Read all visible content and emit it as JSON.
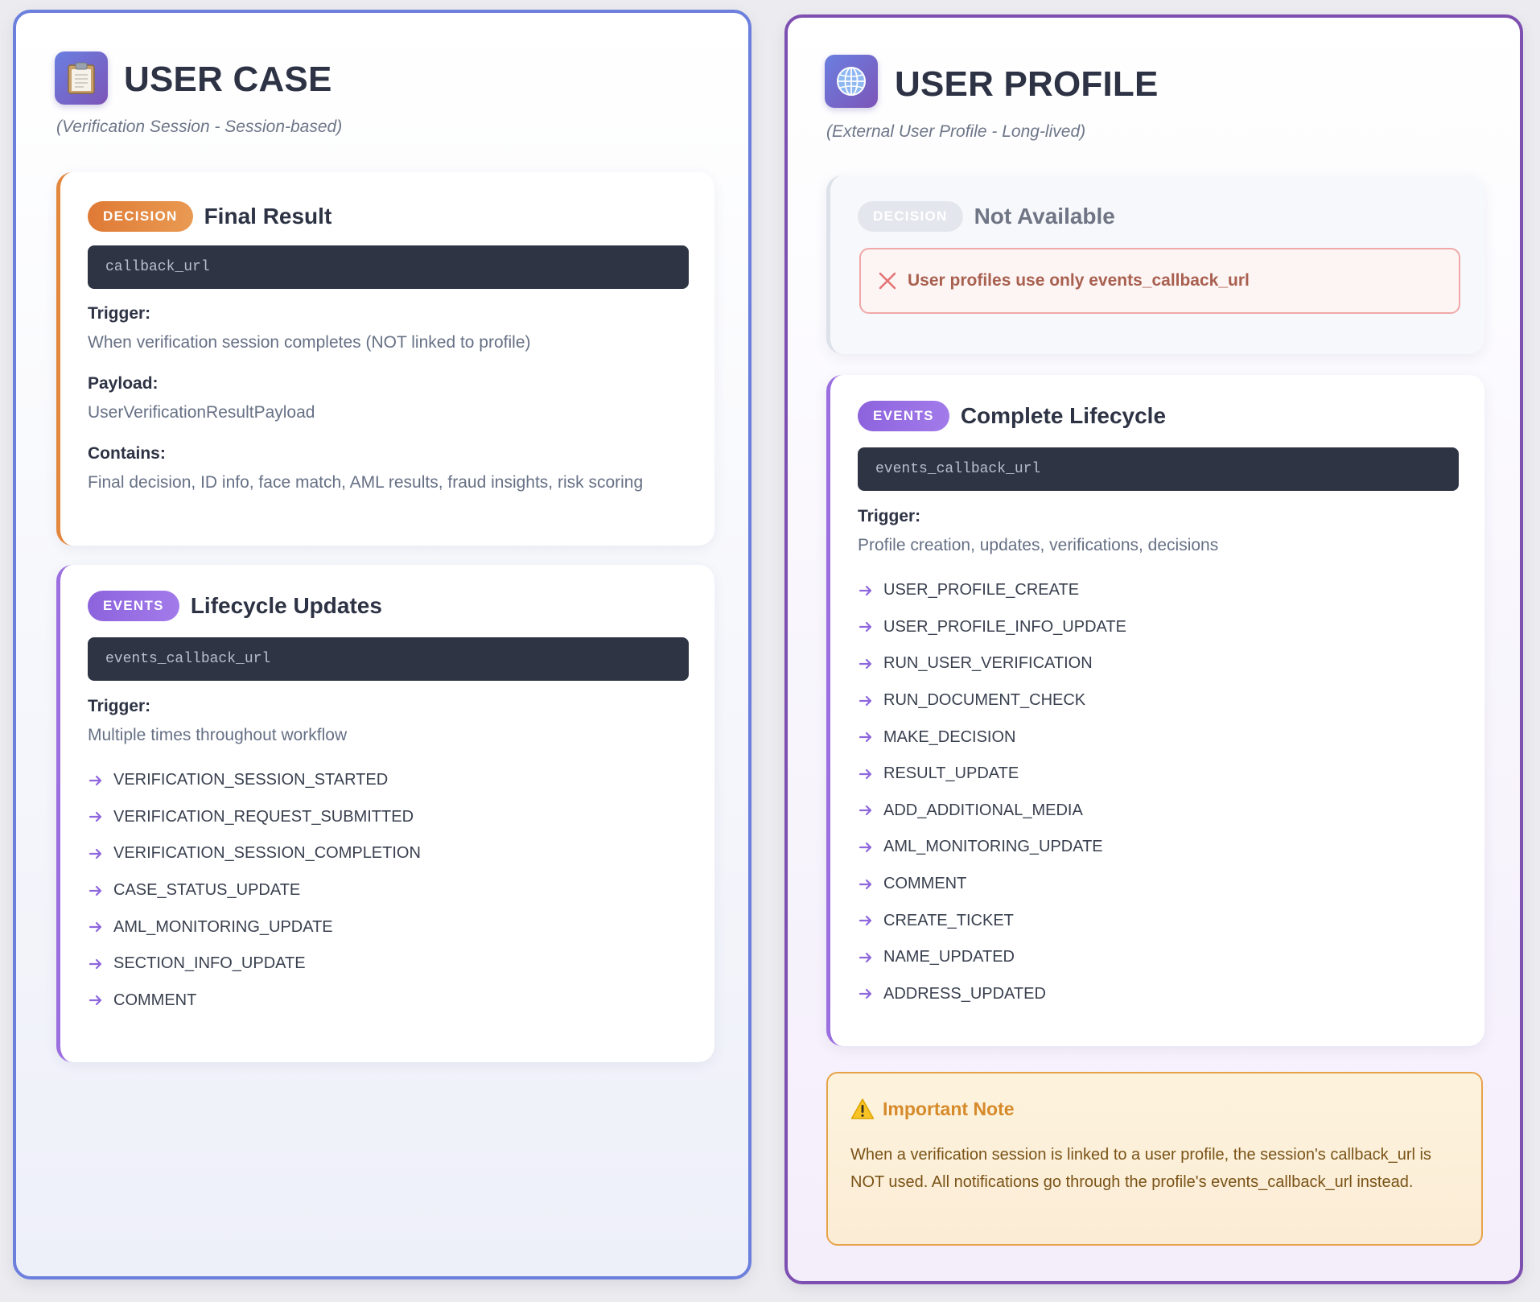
{
  "user_case": {
    "title": "USER CASE",
    "subtitle": "(Verification Session - Session-based)",
    "icon": "clipboard-icon",
    "decision_card": {
      "badge": "DECISION",
      "title": "Final Result",
      "code": "callback_url",
      "trigger_label": "Trigger:",
      "trigger_value": "When verification session completes (NOT linked to profile)",
      "payload_label": "Payload:",
      "payload_value": "UserVerificationResultPayload",
      "contains_label": "Contains:",
      "contains_value": "Final decision, ID info, face match, AML results, fraud insights, risk scoring"
    },
    "events_card": {
      "badge": "EVENTS",
      "title": "Lifecycle Updates",
      "code": "events_callback_url",
      "trigger_label": "Trigger:",
      "trigger_value": "Multiple times throughout workflow",
      "events": [
        "VERIFICATION_SESSION_STARTED",
        "VERIFICATION_REQUEST_SUBMITTED",
        "VERIFICATION_SESSION_COMPLETION",
        "CASE_STATUS_UPDATE",
        "AML_MONITORING_UPDATE",
        "SECTION_INFO_UPDATE",
        "COMMENT"
      ]
    }
  },
  "user_profile": {
    "title": "USER PROFILE",
    "subtitle": "(External User Profile - Long-lived)",
    "icon": "globe-icon",
    "decision_card": {
      "badge": "DECISION",
      "title": "Not Available",
      "alert_text": "User profiles use only events_callback_url"
    },
    "events_card": {
      "badge": "EVENTS",
      "title": "Complete Lifecycle",
      "code": "events_callback_url",
      "trigger_label": "Trigger:",
      "trigger_value": "Profile creation, updates, verifications, decisions",
      "events": [
        "USER_PROFILE_CREATE",
        "USER_PROFILE_INFO_UPDATE",
        "RUN_USER_VERIFICATION",
        "RUN_DOCUMENT_CHECK",
        "MAKE_DECISION",
        "RESULT_UPDATE",
        "ADD_ADDITIONAL_MEDIA",
        "AML_MONITORING_UPDATE",
        "COMMENT",
        "CREATE_TICKET",
        "NAME_UPDATED",
        "ADDRESS_UPDATED"
      ]
    },
    "note": {
      "title": "Important Note",
      "text": "When a verification session is linked to a user profile, the session's callback_url is NOT used. All notifications go through the profile's events_callback_url instead."
    }
  },
  "colors": {
    "case_border": "#6c7fdd",
    "profile_border": "#7d4fb0",
    "decision_accent": "#e3873d",
    "events_accent": "#9b6fe0",
    "code_background": "#2e3443",
    "alert_border": "#f0a8a8",
    "note_border": "#e7a34a"
  }
}
